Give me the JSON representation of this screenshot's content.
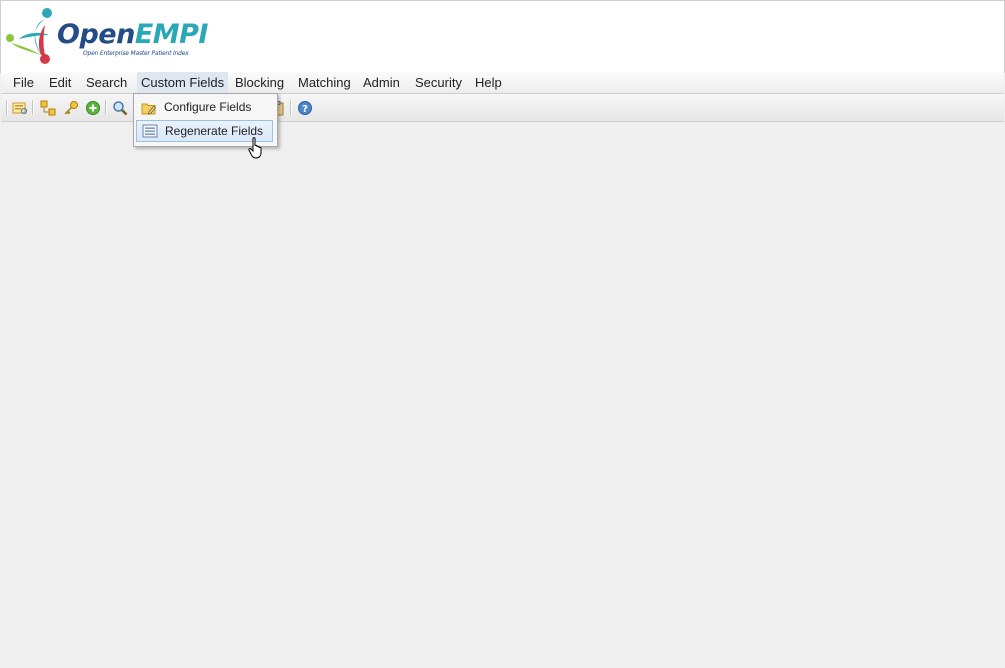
{
  "app": {
    "logo_main_part1": "Open",
    "logo_main_part2": "EMPI",
    "logo_tagline": "Open Enterprise Master Patient Index"
  },
  "menubar": {
    "items": [
      {
        "label": "File"
      },
      {
        "label": "Edit"
      },
      {
        "label": "Search"
      },
      {
        "label": "Custom Fields",
        "active": true
      },
      {
        "label": "Blocking"
      },
      {
        "label": "Matching"
      },
      {
        "label": "Admin"
      },
      {
        "label": "Security"
      },
      {
        "label": "Help"
      }
    ]
  },
  "toolbar": {
    "buttons": [
      "browse-icon",
      "link-icon",
      "key-icon",
      "add-icon",
      "search-icon",
      "clipboard-icon",
      "help-icon"
    ]
  },
  "dropdown": {
    "items": [
      {
        "label": "Configure Fields",
        "icon": "folder-edit-icon"
      },
      {
        "label": "Regenerate Fields",
        "icon": "list-icon",
        "hovered": true
      }
    ]
  },
  "colors": {
    "logo_blue": "#234c86",
    "logo_teal": "#2aa8b6",
    "logo_red": "#d23a48",
    "logo_green": "#8cc63e",
    "menu_active": "#dde6f1",
    "hover_border": "#9fbfe2"
  }
}
